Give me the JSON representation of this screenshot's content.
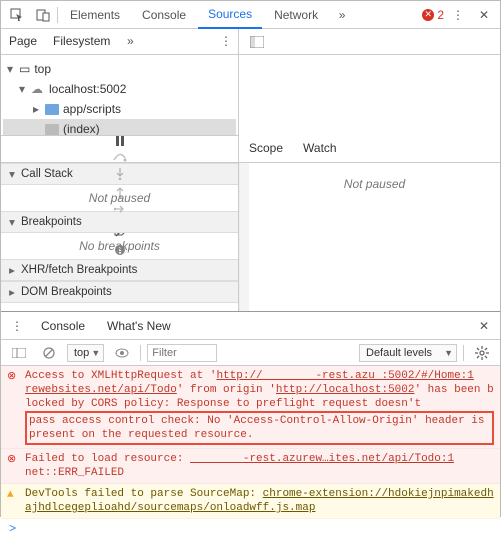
{
  "top_tabs": {
    "elements": "Elements",
    "console": "Console",
    "sources": "Sources",
    "network": "Network"
  },
  "error_count": "2",
  "page_tabs": {
    "page": "Page",
    "filesystem": "Filesystem"
  },
  "tree": {
    "top": "top",
    "host": "localhost:5002",
    "folder": "app/scripts",
    "file": "(index)"
  },
  "scope_tabs": {
    "scope": "Scope",
    "watch": "Watch"
  },
  "not_paused": "Not paused",
  "sections": {
    "call_stack": "Call Stack",
    "breakpoints": "Breakpoints",
    "xhr": "XHR/fetch Breakpoints",
    "dom": "DOM Breakpoints"
  },
  "no_breakpoints": "No breakpoints",
  "drawer_tabs": {
    "console": "Console",
    "whatsnew": "What's New"
  },
  "console_ctx": "top",
  "filter_placeholder": "Filter",
  "default_levels": "Default levels",
  "messages": {
    "m1_pre": "Access to XMLHttpRequest at '",
    "m1_url1": "http://        -rest.azu :5002/#/Home:1",
    "m1_mid1": "rewebsites.net/api/Todo",
    "m1_mid2": "' from origin '",
    "m1_url2": "http://localhost:5002",
    "m1_mid3": "' has been blocked by CORS policy: Response to preflight request doesn't ",
    "m1_hl": "pass access control check: No 'Access-Control-Allow-Origin' header is present on the requested resource.",
    "m2_pre": "Failed to load resource: ",
    "m2_url": "        -rest.azurew…ites.net/api/Todo:1",
    "m2_code": "net::ERR_FAILED",
    "m3_pre": "DevTools failed to parse SourceMap: ",
    "m3_url": "chrome-extension://hdokiejnpimakedhajhdlcegeplioahd/sourcemaps/onloadwff.js.map"
  },
  "prompt": ">"
}
